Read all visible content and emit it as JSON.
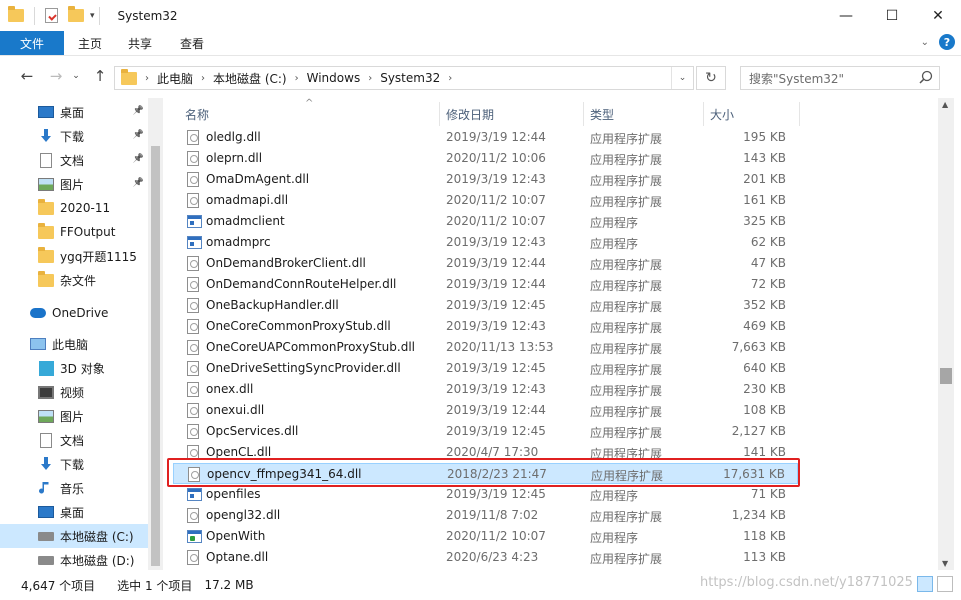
{
  "window": {
    "title": "System32"
  },
  "ribbon": {
    "tabs": [
      "文件",
      "主页",
      "共享",
      "查看"
    ]
  },
  "address": {
    "crumbs": [
      "此电脑",
      "本地磁盘 (C:)",
      "Windows",
      "System32"
    ]
  },
  "search": {
    "placeholder": "搜索\"System32\""
  },
  "sidebar": {
    "items": [
      {
        "label": "桌面",
        "icon": "desktop-icon",
        "pinned": true
      },
      {
        "label": "下载",
        "icon": "download-icon",
        "pinned": true
      },
      {
        "label": "文档",
        "icon": "document-icon",
        "pinned": true
      },
      {
        "label": "图片",
        "icon": "pictures-icon",
        "pinned": true
      },
      {
        "label": "2020-11",
        "icon": "folder-icon",
        "pinned": false
      },
      {
        "label": "FFOutput",
        "icon": "folder-icon",
        "pinned": false
      },
      {
        "label": "ygq开题1115",
        "icon": "folder-icon",
        "pinned": false
      },
      {
        "label": "杂文件",
        "icon": "folder-icon",
        "pinned": false
      },
      {
        "label": "OneDrive",
        "icon": "onedrive-icon",
        "pinned": false
      },
      {
        "label": "此电脑",
        "icon": "this-pc-icon",
        "pinned": false
      },
      {
        "label": "3D 对象",
        "icon": "3d-objects-icon",
        "pinned": false
      },
      {
        "label": "视频",
        "icon": "videos-icon",
        "pinned": false
      },
      {
        "label": "图片",
        "icon": "pictures-icon",
        "pinned": false
      },
      {
        "label": "文档",
        "icon": "document-icon",
        "pinned": false
      },
      {
        "label": "下载",
        "icon": "download-icon",
        "pinned": false
      },
      {
        "label": "音乐",
        "icon": "music-icon",
        "pinned": false
      },
      {
        "label": "桌面",
        "icon": "desktop-icon",
        "pinned": false
      },
      {
        "label": "本地磁盘 (C:)",
        "icon": "drive-icon",
        "pinned": false
      },
      {
        "label": "本地磁盘 (D:)",
        "icon": "drive-icon",
        "pinned": false
      }
    ]
  },
  "columns": {
    "name": "名称",
    "date": "修改日期",
    "type": "类型",
    "size": "大小"
  },
  "files": [
    {
      "name": "oledlg.dll",
      "date": "2019/3/19 12:44",
      "type": "应用程序扩展",
      "size": "195 KB",
      "kind": "dll"
    },
    {
      "name": "oleprn.dll",
      "date": "2020/11/2 10:06",
      "type": "应用程序扩展",
      "size": "143 KB",
      "kind": "dll"
    },
    {
      "name": "OmaDmAgent.dll",
      "date": "2019/3/19 12:43",
      "type": "应用程序扩展",
      "size": "201 KB",
      "kind": "dll"
    },
    {
      "name": "omadmapi.dll",
      "date": "2020/11/2 10:07",
      "type": "应用程序扩展",
      "size": "161 KB",
      "kind": "dll"
    },
    {
      "name": "omadmclient",
      "date": "2020/11/2 10:07",
      "type": "应用程序",
      "size": "325 KB",
      "kind": "exe"
    },
    {
      "name": "omadmprc",
      "date": "2019/3/19 12:43",
      "type": "应用程序",
      "size": "62 KB",
      "kind": "exe"
    },
    {
      "name": "OnDemandBrokerClient.dll",
      "date": "2019/3/19 12:44",
      "type": "应用程序扩展",
      "size": "47 KB",
      "kind": "dll"
    },
    {
      "name": "OnDemandConnRouteHelper.dll",
      "date": "2019/3/19 12:44",
      "type": "应用程序扩展",
      "size": "72 KB",
      "kind": "dll"
    },
    {
      "name": "OneBackupHandler.dll",
      "date": "2019/3/19 12:45",
      "type": "应用程序扩展",
      "size": "352 KB",
      "kind": "dll"
    },
    {
      "name": "OneCoreCommonProxyStub.dll",
      "date": "2019/3/19 12:43",
      "type": "应用程序扩展",
      "size": "469 KB",
      "kind": "dll"
    },
    {
      "name": "OneCoreUAPCommonProxyStub.dll",
      "date": "2020/11/13 13:53",
      "type": "应用程序扩展",
      "size": "7,663 KB",
      "kind": "dll"
    },
    {
      "name": "OneDriveSettingSyncProvider.dll",
      "date": "2019/3/19 12:45",
      "type": "应用程序扩展",
      "size": "640 KB",
      "kind": "dll"
    },
    {
      "name": "onex.dll",
      "date": "2019/3/19 12:43",
      "type": "应用程序扩展",
      "size": "230 KB",
      "kind": "dll"
    },
    {
      "name": "onexui.dll",
      "date": "2019/3/19 12:44",
      "type": "应用程序扩展",
      "size": "108 KB",
      "kind": "dll"
    },
    {
      "name": "OpcServices.dll",
      "date": "2019/3/19 12:45",
      "type": "应用程序扩展",
      "size": "2,127 KB",
      "kind": "dll"
    },
    {
      "name": "OpenCL.dll",
      "date": "2020/4/7 17:30",
      "type": "应用程序扩展",
      "size": "141 KB",
      "kind": "dll"
    },
    {
      "name": "opencv_ffmpeg341_64.dll",
      "date": "2018/2/23 21:47",
      "type": "应用程序扩展",
      "size": "17,631 KB",
      "kind": "dll",
      "selected": true
    },
    {
      "name": "openfiles",
      "date": "2019/3/19 12:45",
      "type": "应用程序",
      "size": "71 KB",
      "kind": "exe"
    },
    {
      "name": "opengl32.dll",
      "date": "2019/11/8 7:02",
      "type": "应用程序扩展",
      "size": "1,234 KB",
      "kind": "dll"
    },
    {
      "name": "OpenWith",
      "date": "2020/11/2 10:07",
      "type": "应用程序",
      "size": "118 KB",
      "kind": "exe-green"
    },
    {
      "name": "Optane.dll",
      "date": "2020/6/23 4:23",
      "type": "应用程序扩展",
      "size": "113 KB",
      "kind": "dll"
    }
  ],
  "status": {
    "count": "4,647 个项目",
    "selection": "选中 1 个项目",
    "size": "17.2 MB"
  },
  "watermark": "https://blog.csdn.net/y18771025",
  "colors": {
    "accent": "#1979ca",
    "selection": "#cce8ff",
    "highlight_box": "#e02020",
    "folder": "#f6c85a"
  }
}
